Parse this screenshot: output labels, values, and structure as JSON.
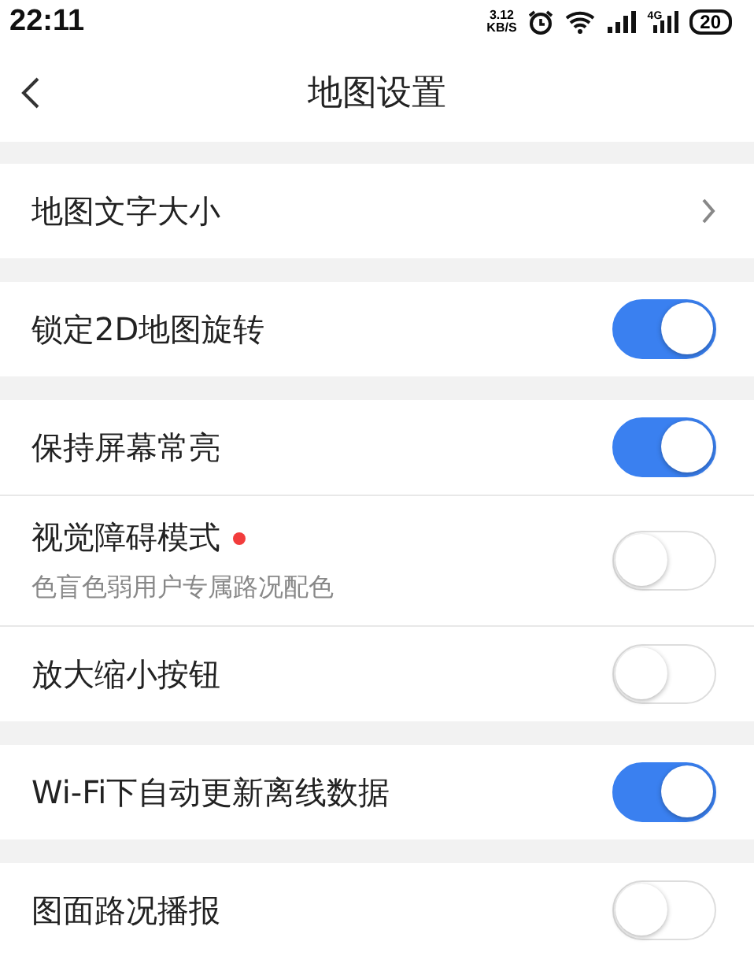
{
  "status_bar": {
    "time": "22:11",
    "speed_value": "3.12",
    "speed_unit": "KB/S",
    "network": "4G",
    "battery": "20"
  },
  "header": {
    "title": "地图设置"
  },
  "groups": [
    {
      "items": [
        {
          "kind": "link",
          "label": "地图文字大小"
        }
      ]
    },
    {
      "items": [
        {
          "kind": "toggle",
          "label": "锁定2D地图旋转",
          "on": true
        }
      ]
    },
    {
      "items": [
        {
          "kind": "toggle",
          "label": "保持屏幕常亮",
          "on": true
        },
        {
          "kind": "toggle",
          "label": "视觉障碍模式",
          "on": false,
          "new_dot": true,
          "subtitle": "色盲色弱用户专属路况配色"
        },
        {
          "kind": "toggle",
          "label": "放大缩小按钮",
          "on": false
        }
      ]
    },
    {
      "items": [
        {
          "kind": "toggle",
          "label": "Wi-Fi下自动更新离线数据",
          "on": true
        }
      ]
    },
    {
      "items": [
        {
          "kind": "toggle",
          "label": "图面路况播报",
          "on": false
        }
      ]
    }
  ]
}
